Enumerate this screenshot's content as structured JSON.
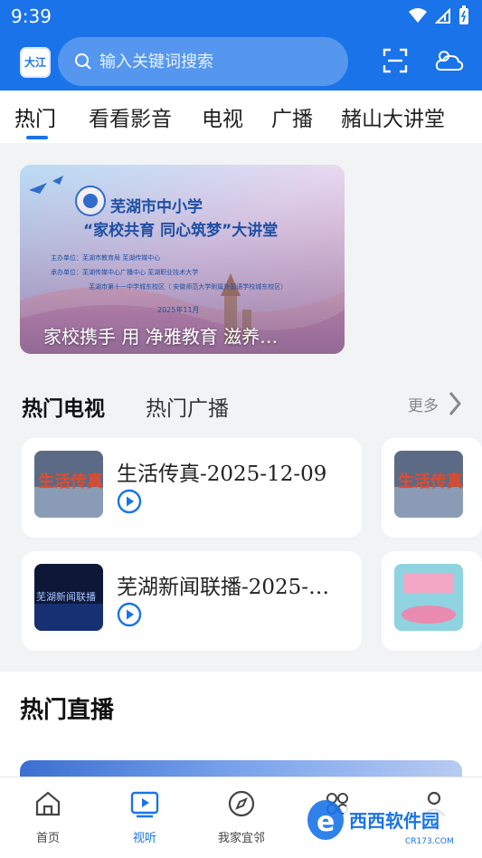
{
  "status_bar": {
    "time": "9:39"
  },
  "header": {
    "logo_text": "大江",
    "search_placeholder": "输入关键词搜索"
  },
  "tabs": [
    {
      "label": "热门",
      "active": true
    },
    {
      "label": "看看影音",
      "active": false
    },
    {
      "label": "电视",
      "active": false
    },
    {
      "label": "广播",
      "active": false
    },
    {
      "label": "赭山大讲堂",
      "active": false
    }
  ],
  "banner": {
    "caption": "家校携手 用 净雅教育 滋养…",
    "title_line1": "芜湖市中小学",
    "title_line2": "“家校共育 同心筑梦”大讲堂",
    "org1": "主办单位：芜湖市教育局  芜湖传媒中心",
    "org2": "承办单位：芜湖传媒中心广播中心  芜湖职业技术大学",
    "org3": "芜湖市第十一中学城东校区（ 安徽师范大学附属外国语学校城东校区）",
    "date": "2025年11月"
  },
  "hot_section": {
    "tab_active": "热门电视",
    "tab_inactive": "热门广播",
    "more_label": "更多"
  },
  "cards": [
    {
      "title": "生活传真-2025-12-09",
      "thumb_text": "生活传真"
    },
    {
      "title": "芜湖新闻联播-2025-…",
      "thumb_text": "芜湖新闻联播"
    }
  ],
  "live_section": {
    "title": "热门直播"
  },
  "bottom_nav": [
    {
      "label": "首页",
      "icon": "home-icon",
      "active": false
    },
    {
      "label": "视听",
      "icon": "video-icon",
      "active": true
    },
    {
      "label": "我家宜邻",
      "icon": "compass-icon",
      "active": false
    },
    {
      "label": "",
      "icon": "apps-icon",
      "active": false
    },
    {
      "label": "",
      "icon": "profile-icon",
      "active": false
    }
  ],
  "watermark": {
    "text": "西西软件园",
    "url_text": "CR173.COM"
  },
  "colors": {
    "brand_blue": "#1a73e8",
    "background": "#f2f3f5"
  }
}
